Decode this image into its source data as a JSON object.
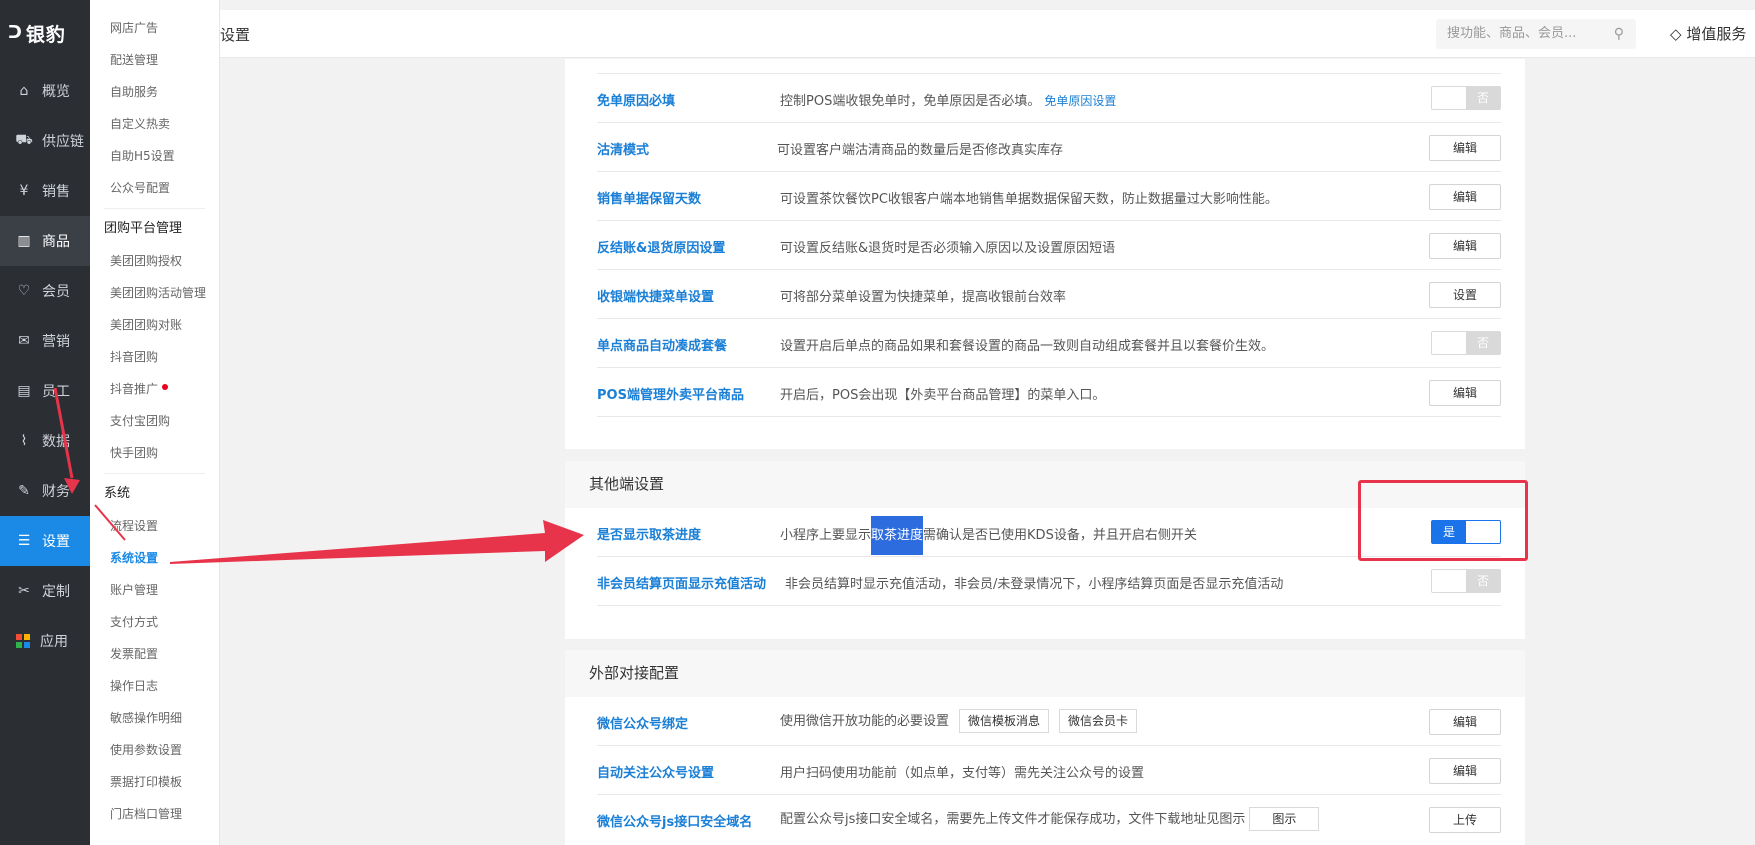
{
  "brand": {
    "logo_text": "银豹",
    "logo_mark": "ᑐ"
  },
  "nav": {
    "items": [
      {
        "icon": "home-icon",
        "glyph": "⌂",
        "label": "概览"
      },
      {
        "icon": "supply-icon",
        "glyph": "⛟",
        "label": "供应链"
      },
      {
        "icon": "sales-icon",
        "glyph": "¥",
        "label": "销售"
      },
      {
        "icon": "goods-icon",
        "glyph": "▥",
        "label": "商品"
      },
      {
        "icon": "member-icon",
        "glyph": "♡",
        "label": "会员"
      },
      {
        "icon": "marketing-icon",
        "glyph": "✉",
        "label": "营销"
      },
      {
        "icon": "staff-icon",
        "glyph": "▤",
        "label": "员工"
      },
      {
        "icon": "data-icon",
        "glyph": "⌇",
        "label": "数据"
      },
      {
        "icon": "finance-icon",
        "glyph": "✎",
        "label": "财务"
      },
      {
        "icon": "settings-icon",
        "glyph": "☰",
        "label": "设置"
      },
      {
        "icon": "custom-icon",
        "glyph": "✂",
        "label": "定制"
      },
      {
        "icon": "apps-icon",
        "glyph": "",
        "label": "应用"
      }
    ],
    "apps_colors": [
      "#f04e37",
      "#ffb400",
      "#2fb34a",
      "#1a8ae6"
    ]
  },
  "submenu": {
    "top_items": [
      "网店广告",
      "配送管理",
      "自助服务",
      "自定义热卖",
      "自助H5设置",
      "公众号配置"
    ],
    "group1_title": "团购平台管理",
    "group1_items": [
      "美团团购授权",
      "美团团购活动管理",
      "美团团购对账",
      "抖音团购",
      "抖音推广",
      "支付宝团购",
      "快手团购"
    ],
    "group2_title": "系统",
    "group2_items": [
      "流程设置",
      "系统设置",
      "账户管理",
      "支付方式",
      "发票配置",
      "操作日志",
      "敏感操作明细",
      "使用参数设置",
      "票据打印模板",
      "门店档口管理"
    ]
  },
  "topbar": {
    "title": "设置",
    "search_placeholder": "搜功能、商品、会员...",
    "vip_label": "增值服务"
  },
  "section1": {
    "rows": [
      {
        "label": "免单原因必填",
        "desc": "控制POS端收银免单时，免单原因是否必填。",
        "link": "免单原因设置",
        "control": "toggle",
        "value": "否"
      },
      {
        "label": "沽清模式",
        "desc": "可设置客户端沽清商品的数量后是否修改真实库存",
        "control": "button",
        "value": "编辑"
      },
      {
        "label": "销售单据保留天数",
        "desc": "可设置茶饮餐饮PC收银客户端本地销售单据数据保留天数，防止数据量过大影响性能。",
        "control": "button",
        "value": "编辑"
      },
      {
        "label": "反结账&退货原因设置",
        "desc": "可设置反结账&退货时是否必须输入原因以及设置原因短语",
        "control": "button",
        "value": "编辑"
      },
      {
        "label": "收银端快捷菜单设置",
        "desc": "可将部分菜单设置为快捷菜单，提高收银前台效率",
        "control": "button",
        "value": "设置"
      },
      {
        "label": "单点商品自动凑成套餐",
        "desc": "设置开启后单点的商品如果和套餐设置的商品一致则自动组成套餐并且以套餐价生效。",
        "control": "toggle",
        "value": "否"
      },
      {
        "label": "POS端管理外卖平台商品",
        "desc": "开启后，POS会出现【外卖平台商品管理】的菜单入口。",
        "control": "button",
        "value": "编辑"
      }
    ]
  },
  "section2": {
    "title": "其他端设置",
    "row1": {
      "label": "是否显示取茶进度",
      "desc_before": "小程序上要显示",
      "desc_highlight": "取茶进度",
      "desc_after": "需确认是否已使用KDS设备，并且开启右侧开关",
      "value": "是"
    },
    "row2": {
      "label": "非会员结算页面显示充值活动",
      "desc": "非会员结算时显示充值活动，非会员/未登录情况下，小程序结算页面是否显示充值活动",
      "value": "否"
    }
  },
  "section3": {
    "title": "外部对接配置",
    "row1": {
      "label": "微信公众号绑定",
      "desc": "使用微信开放功能的必要设置",
      "tag1": "微信模板消息",
      "tag2": "微信会员卡",
      "value": "编辑"
    },
    "row2": {
      "label": "自动关注公众号设置",
      "desc": "用户扫码使用功能前（如点单，支付等）需先关注公众号的设置",
      "value": "编辑"
    },
    "row3": {
      "label": "微信公众号js接口安全域名",
      "desc": "配置公众号js接口安全域名，需要先上传文件才能保存成功，文件下载地址见图示",
      "tag": "图示",
      "value": "上传"
    }
  },
  "annotation_color": "#e8344a"
}
